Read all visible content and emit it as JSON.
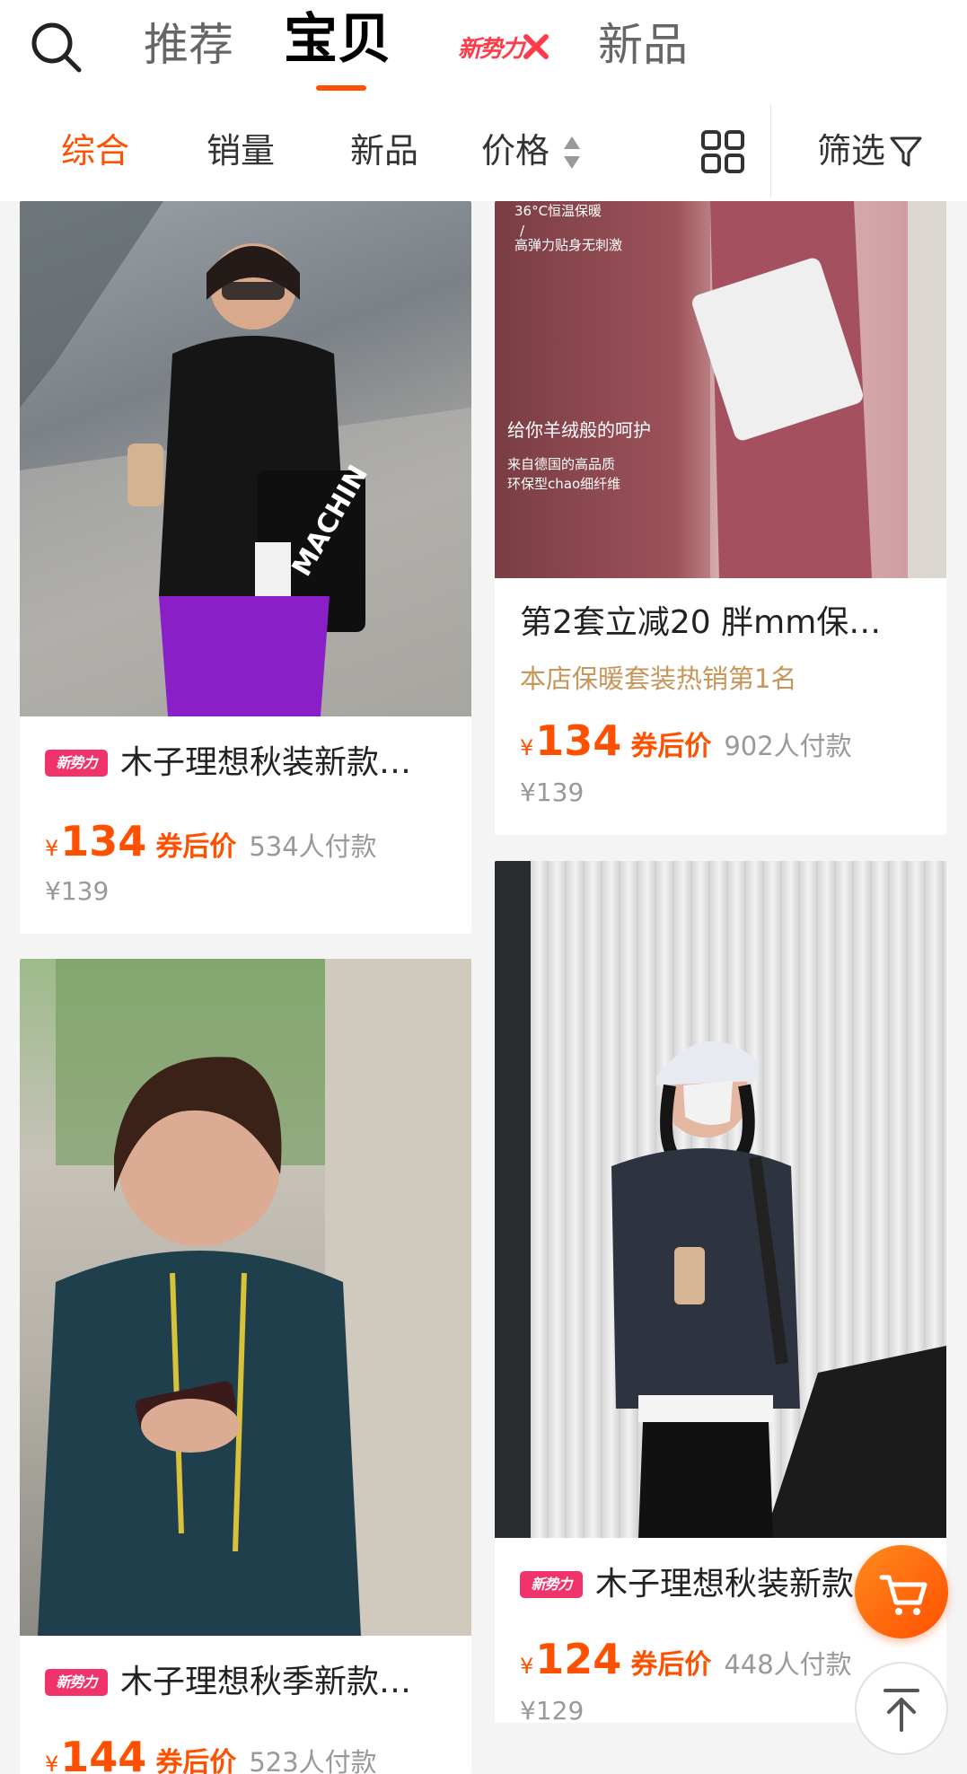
{
  "header": {
    "tabs": [
      {
        "label": "推荐",
        "active": false
      },
      {
        "label": "宝贝",
        "active": true
      },
      {
        "label": "新势力",
        "active": false
      },
      {
        "label": "新品",
        "active": false
      }
    ]
  },
  "filter_bar": {
    "items": [
      "综合",
      "销量",
      "新品",
      "价格"
    ],
    "active": "综合",
    "filter_label": "筛选"
  },
  "products": [
    {
      "badge": "新势力",
      "title": "木子理想秋装新款…",
      "subtitle": "",
      "yen": "¥",
      "price": "134",
      "coupon_label": "券后价",
      "sold": "534人付款",
      "original_price": "¥139"
    },
    {
      "badge": "",
      "title": "第2套立减20 胖mm保…",
      "subtitle": "本店保暖套装热销第1名",
      "yen": "¥",
      "price": "134",
      "coupon_label": "券后价",
      "sold": "902人付款",
      "original_price": "¥139",
      "image_text": {
        "l1": "36°C恒温保暖",
        "l2": "/",
        "l3": "高弹力贴身无刺激",
        "l4": "给你羊绒般的呵护",
        "l5": "来自德国的高品质",
        "l6": "环保型chao细纤维"
      }
    },
    {
      "badge": "新势力",
      "title": "木子理想秋季新款…",
      "subtitle": "",
      "yen": "¥",
      "price": "144",
      "coupon_label": "券后价",
      "sold": "523人付款",
      "original_price": ""
    },
    {
      "badge": "新势力",
      "title": "木子理想秋装新款",
      "subtitle": "",
      "yen": "¥",
      "price": "124",
      "coupon_label": "券后价",
      "sold": "448人付款",
      "original_price": "¥129"
    }
  ],
  "icons": {
    "search": "search-icon",
    "sort": "sort-arrows-icon",
    "layout": "grid-view-icon",
    "filter": "funnel-icon",
    "cart": "shopping-cart-icon",
    "top": "back-to-top-icon"
  },
  "colors": {
    "accent": "#ff5000",
    "badge": "#f0336b",
    "subtitle": "#c8955b",
    "muted": "#999999"
  }
}
